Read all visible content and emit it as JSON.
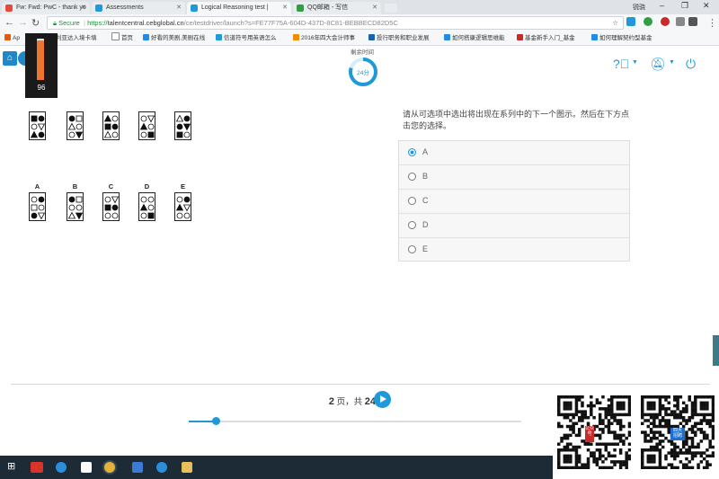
{
  "browser": {
    "tabs": [
      {
        "label": "Fw: Fwd: PwC - thank yo",
        "active": false,
        "favicon_color": "#e34a3b"
      },
      {
        "label": "Assessments",
        "active": false,
        "favicon_color": "#1f99d8"
      },
      {
        "label": "Logical Reasoning test |",
        "active": true,
        "favicon_color": "#1f99d8"
      },
      {
        "label": "QQ邮箱 - 写信",
        "active": false,
        "favicon_color": "#2f9e44"
      }
    ],
    "user": "锐骁",
    "url_secure": "Secure",
    "url_scheme": "https://",
    "url_host": "talentcentral.cebglobal.cn",
    "url_path": "/ce/testdriver/launch?s=FE77F75A-604D-437D-8C81-BEBBECD82D5C",
    "bookmarks": [
      {
        "label": "Ap",
        "icon_color": "#e8590c"
      },
      {
        "label": "利亚达入境卡填",
        "icon_color": "#555"
      },
      {
        "label": "首页",
        "icon_color": "#888"
      },
      {
        "label": "好看的美剧,美剧在线",
        "icon_color": "#228be6"
      },
      {
        "label": "信道符号用英语怎么",
        "icon_color": "#1f99d8"
      },
      {
        "label": "2016年四大会计师事",
        "icon_color": "#f08c00"
      },
      {
        "label": "投行职务和职业发展",
        "icon_color": "#1864ab"
      },
      {
        "label": "如何搭康逻辑思维能",
        "icon_color": "#228be6"
      },
      {
        "label": "基金新手入门_基金",
        "icon_color": "#c92a2a"
      },
      {
        "label": "如何理解契约型基金",
        "icon_color": "#228be6"
      }
    ]
  },
  "volume": {
    "value": "96",
    "level": 0.96
  },
  "timer": {
    "label": "剩余时间",
    "value": "24分",
    "remaining_fraction": 0.8
  },
  "question": {
    "text": "请从可选项中选出将出现在系列中的下一个图示。然后在下方点击您的选择。",
    "options": [
      {
        "label": "A",
        "selected": true
      },
      {
        "label": "B",
        "selected": false
      },
      {
        "label": "C",
        "selected": false
      },
      {
        "label": "D",
        "selected": false
      },
      {
        "label": "E",
        "selected": false
      }
    ],
    "answer_letters": [
      "A",
      "B",
      "C",
      "D",
      "E"
    ]
  },
  "figures": {
    "sequence": [
      [
        [
          "sq-f",
          "circ-f"
        ],
        [
          "circ-o",
          "tri-d-o"
        ],
        [
          "tri-u-f",
          "circ-f"
        ]
      ],
      [
        [
          "circ-f",
          "sq-o"
        ],
        [
          "tri-u-o",
          "circ-o"
        ],
        [
          "circ-o",
          "tri-d-f"
        ]
      ],
      [
        [
          "tri-u-f",
          "circ-o"
        ],
        [
          "sq-f",
          "circ-f"
        ],
        [
          "tri-u-o",
          "circ-o"
        ]
      ],
      [
        [
          "circ-o",
          "tri-d-o"
        ],
        [
          "tri-u-f",
          "circ-o"
        ],
        [
          "circ-o",
          "sq-f"
        ]
      ],
      [
        [
          "tri-u-o",
          "circ-f"
        ],
        [
          "circ-f",
          "tri-d-f"
        ],
        [
          "sq-f",
          "circ-o"
        ]
      ]
    ],
    "answers": [
      [
        [
          "circ-o",
          "circ-f"
        ],
        [
          "sq-o",
          "circ-o"
        ],
        [
          "circ-f",
          "tri-d-o"
        ]
      ],
      [
        [
          "circ-f",
          "sq-o"
        ],
        [
          "circ-o",
          "circ-o"
        ],
        [
          "tri-u-o",
          "tri-d-f"
        ]
      ],
      [
        [
          "circ-o",
          "tri-d-o"
        ],
        [
          "sq-f",
          "circ-f"
        ],
        [
          "circ-o",
          "circ-o"
        ]
      ],
      [
        [
          "circ-o",
          "circ-o"
        ],
        [
          "tri-u-f",
          "circ-o"
        ],
        [
          "circ-o",
          "sq-f"
        ]
      ],
      [
        [
          "circ-o",
          "circ-f"
        ],
        [
          "tri-u-f",
          "tri-d-o"
        ],
        [
          "circ-o",
          "circ-o"
        ]
      ]
    ]
  },
  "pager": {
    "current": "2",
    "sep1": " 页，共 ",
    "total": "24"
  },
  "progress": {
    "fraction": 0.08
  },
  "qr": {
    "left_tag": "公众号",
    "right_tag": "四大 招聘"
  },
  "colors": {
    "accent": "#1f99d8",
    "volume": "#f0752c"
  }
}
